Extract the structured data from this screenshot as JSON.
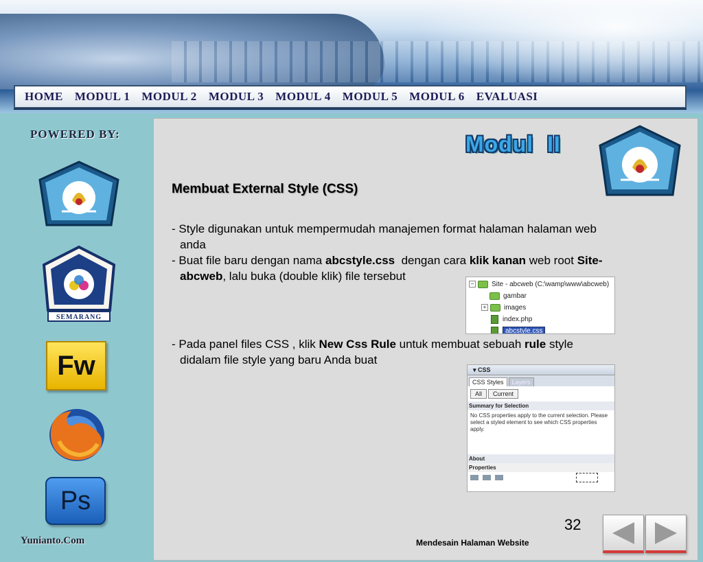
{
  "nav": [
    "HOME",
    "MODUL 1",
    "MODUL 2",
    "MODUL 3",
    "MODUL 4",
    "MODUL 5",
    "MODUL 6",
    "EVALUASI"
  ],
  "sidebar": {
    "powered_by": "POWERED BY:",
    "emblem_label": "SEMARANG",
    "fw_label": "Fw",
    "ps_label": "Ps",
    "footer_brand": "Yunianto.Com"
  },
  "content": {
    "modul_title": "Modul  II",
    "heading": "Membuat External Style (CSS)",
    "p1_line1": "- Style digunakan untuk mempermudah manajemen format halaman halaman web",
    "p1_line2": "anda",
    "p2_a": "- Buat file baru dengan nama ",
    "p2_b": "abcstyle.css",
    "p2_c": "  dengan cara ",
    "p2_d": "klik kanan",
    "p2_e": " web root ",
    "p2_f": "Site-",
    "p2_g": "abcweb",
    "p2_h": ", lalu buka (double klik) file tersebut",
    "p3_a": "- Pada panel files CSS , klik ",
    "p3_b": "New Css Rule",
    "p3_c": " untuk membuat sebuah ",
    "p3_d": "rule",
    "p3_e": " style",
    "p3_line2": "didalam file style yang baru Anda buat"
  },
  "file_tree": {
    "root": "Site - abcweb (C:\\wamp\\www\\abcweb)",
    "items": [
      "gambar",
      "images",
      "index.php",
      "abcstyle.css"
    ]
  },
  "css_panel": {
    "title": "▾ CSS",
    "tab_active": "CSS Styles",
    "tab_inactive": "Layers",
    "btn_all": "All",
    "btn_current": "Current",
    "summary_label": "Summary for Selection",
    "summary_text": "No CSS properties apply to the current selection. Please select a styled element to see which CSS properties apply.",
    "about_label": "About",
    "properties_label": "Properties"
  },
  "footer": {
    "page_number": "32",
    "title": "Mendesain Halaman Website"
  },
  "colors": {
    "sidebar_bg": "#8fc7cf",
    "panel_bg": "#dcdcdc",
    "nav_text": "#1c1c55",
    "modul_title": "#3aa7e6",
    "nav_arrow": "#9a9a9a",
    "nav_button_accent": "#d43a3a"
  }
}
